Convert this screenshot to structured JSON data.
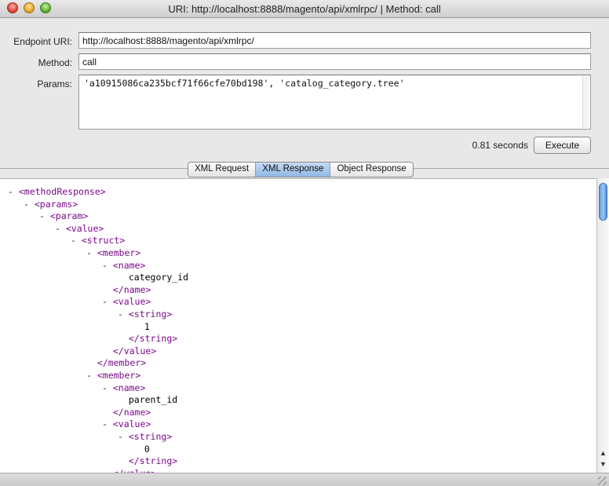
{
  "window": {
    "title": "URI: http://localhost:8888/magento/api/xmlrpc/ | Method: call"
  },
  "form": {
    "endpoint_label": "Endpoint URI:",
    "endpoint_value": "http://localhost:8888/magento/api/xmlrpc/",
    "method_label": "Method:",
    "method_value": "call",
    "params_label": "Params:",
    "params_value": "'a10915086ca235bcf71f66cfe70bd198', 'catalog_category.tree'"
  },
  "execution": {
    "elapsed": "0.81 seconds",
    "execute_label": "Execute"
  },
  "tabs": [
    {
      "label": "XML Request",
      "active": false
    },
    {
      "label": "XML Response",
      "active": true
    },
    {
      "label": "Object Response",
      "active": false
    }
  ],
  "tree": [
    {
      "toggle": "-",
      "tag": "<methodResponse>",
      "indent": 0
    },
    {
      "toggle": "-",
      "tag": "<params>",
      "indent": 1
    },
    {
      "toggle": "-",
      "tag": "<param>",
      "indent": 2
    },
    {
      "toggle": "-",
      "tag": "<value>",
      "indent": 3
    },
    {
      "toggle": "-",
      "tag": "<struct>",
      "indent": 4
    },
    {
      "toggle": "-",
      "tag": "<member>",
      "indent": 5
    },
    {
      "toggle": "-",
      "tag": "<name>",
      "indent": 6
    },
    {
      "toggle": "",
      "text": "category_id",
      "indent": 7
    },
    {
      "toggle": "",
      "tag": "</name>",
      "indent": 6
    },
    {
      "toggle": "-",
      "tag": "<value>",
      "indent": 6
    },
    {
      "toggle": "-",
      "tag": "<string>",
      "indent": 7
    },
    {
      "toggle": "",
      "text": "1",
      "indent": 8
    },
    {
      "toggle": "",
      "tag": "</string>",
      "indent": 7
    },
    {
      "toggle": "",
      "tag": "</value>",
      "indent": 6
    },
    {
      "toggle": "",
      "tag": "</member>",
      "indent": 5
    },
    {
      "toggle": "-",
      "tag": "<member>",
      "indent": 5
    },
    {
      "toggle": "-",
      "tag": "<name>",
      "indent": 6
    },
    {
      "toggle": "",
      "text": "parent_id",
      "indent": 7
    },
    {
      "toggle": "",
      "tag": "</name>",
      "indent": 6
    },
    {
      "toggle": "-",
      "tag": "<value>",
      "indent": 6
    },
    {
      "toggle": "-",
      "tag": "<string>",
      "indent": 7
    },
    {
      "toggle": "",
      "text": "0",
      "indent": 8
    },
    {
      "toggle": "",
      "tag": "</string>",
      "indent": 7
    },
    {
      "toggle": "",
      "tag": "</value>",
      "indent": 6
    }
  ],
  "icons": {
    "close": "close-icon",
    "minimize": "minimize-icon",
    "zoom": "zoom-icon",
    "scroll_up": "arrow-up-icon",
    "scroll_down": "arrow-down-icon",
    "resize": "resize-grip-icon"
  },
  "colors": {
    "tag": "#7a0a8a",
    "active_tab": "#8fb6e6",
    "scroll_thumb": "#5f9be0"
  }
}
